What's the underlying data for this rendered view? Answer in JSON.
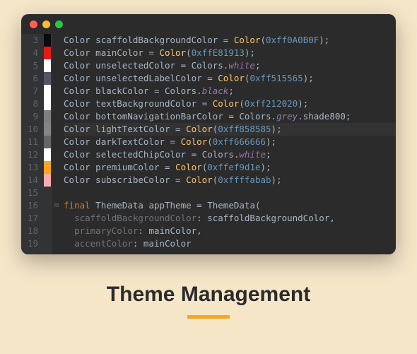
{
  "title": "Theme Management",
  "gutter": [
    "3",
    "4",
    "5",
    "6",
    "7",
    "8",
    "9",
    "10",
    "11",
    "12",
    "13",
    "14",
    "15",
    "16",
    "17",
    "18",
    "19"
  ],
  "markers": [
    "#0a0b0f",
    "#e81919",
    "#ffffff",
    "#515565",
    "#ffffff",
    "#ffffff",
    "#808080",
    "#858585",
    "#666666",
    "#ffffff",
    "#f5a623",
    "#ffabab",
    "",
    "",
    "",
    "",
    ""
  ],
  "fold": [
    "",
    "",
    "",
    "",
    "",
    "",
    "",
    "",
    "",
    "",
    "",
    "",
    "",
    "⊟",
    "",
    "",
    ""
  ],
  "lines": [
    {
      "t": "decl",
      "name": "scaffoldBackgroundColor",
      "expr": "Color",
      "arg": "0xff0A0B0F"
    },
    {
      "t": "decl",
      "name": "mainColor",
      "expr": "Color",
      "arg": "0xffE81913"
    },
    {
      "t": "decl",
      "name": "unselectedColor",
      "expr": "Colors",
      "prop": "white"
    },
    {
      "t": "decl",
      "name": "unselectedLabelColor",
      "expr": "Color",
      "arg": "0xff515565"
    },
    {
      "t": "decl",
      "name": "blackColor",
      "expr": "Colors",
      "prop": "black"
    },
    {
      "t": "decl",
      "name": "textBackgroundColor",
      "expr": "Color",
      "arg": "0xff212020"
    },
    {
      "t": "decl",
      "name": "bottomNavigationBarColor",
      "expr": "Colors",
      "prop": "grey",
      "chain": "shade800"
    },
    {
      "t": "decl",
      "name": "lightTextColor",
      "expr": "Color",
      "arg": "0xff858585",
      "hl": true
    },
    {
      "t": "decl",
      "name": "darkTextColor",
      "expr": "Color",
      "arg": "0xff666666"
    },
    {
      "t": "decl",
      "name": "selectedChipColor",
      "expr": "Colors",
      "prop": "white"
    },
    {
      "t": "decl",
      "name": "premiumColor",
      "expr": "Color",
      "arg": "0xffef9d1e"
    },
    {
      "t": "decl",
      "name": "subscribeColor",
      "expr": "Color",
      "arg": "0xffffabab"
    },
    {
      "t": "blank"
    },
    {
      "t": "final"
    },
    {
      "t": "param",
      "name": "scaffoldBackgroundColor",
      "val": "scaffoldBackgroundColor"
    },
    {
      "t": "param",
      "name": "primaryColor",
      "val": "mainColor"
    },
    {
      "t": "param",
      "name": "accentColor",
      "val": "mainColor",
      "cut": true
    }
  ],
  "finalLine": {
    "kw": "final",
    "type": "ThemeData",
    "name": "appTheme",
    "ctor": "ThemeData"
  }
}
